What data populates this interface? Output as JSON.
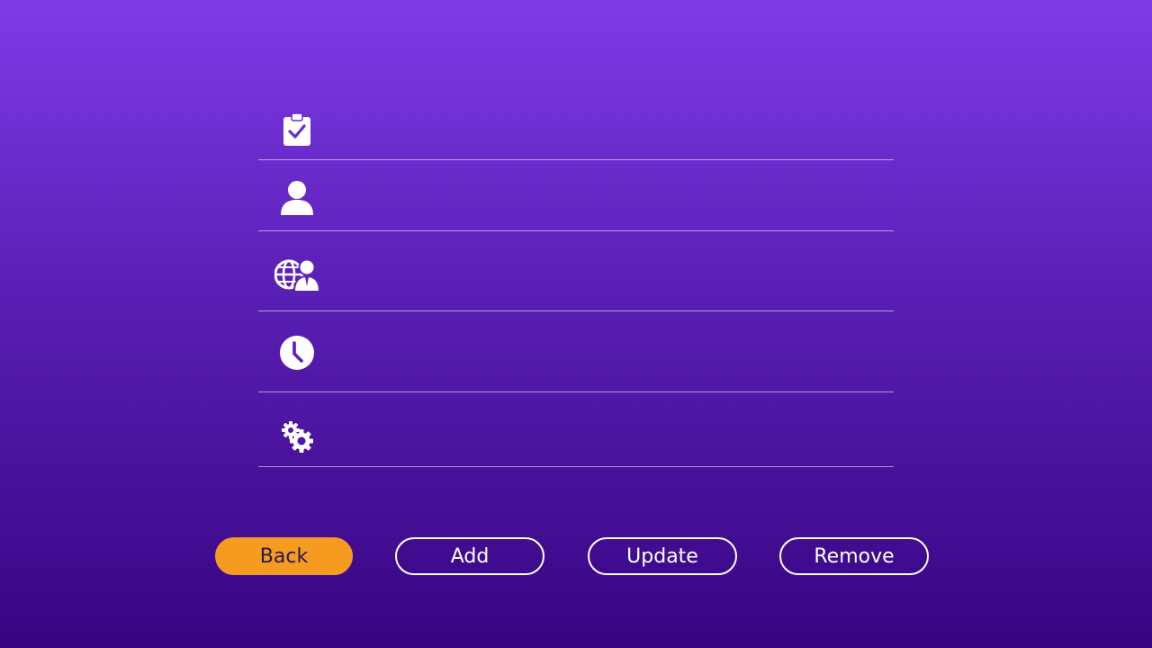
{
  "form": {
    "rows": [
      {
        "icon": "clipboard-check-icon",
        "value": "",
        "placeholder": ""
      },
      {
        "icon": "user-icon",
        "value": "",
        "placeholder": ""
      },
      {
        "icon": "globe-person-icon",
        "value": "",
        "placeholder": ""
      },
      {
        "icon": "clock-icon",
        "value": "",
        "placeholder": ""
      },
      {
        "icon": "gears-icon",
        "value": "",
        "placeholder": ""
      }
    ]
  },
  "buttons": {
    "back_label": "Back",
    "add_label": "Add",
    "update_label": "Update",
    "remove_label": "Remove"
  },
  "colors": {
    "background_top": "#7e3be8",
    "background_bottom": "#370582",
    "accent": "#f59b20",
    "divider": "#ffffff"
  }
}
